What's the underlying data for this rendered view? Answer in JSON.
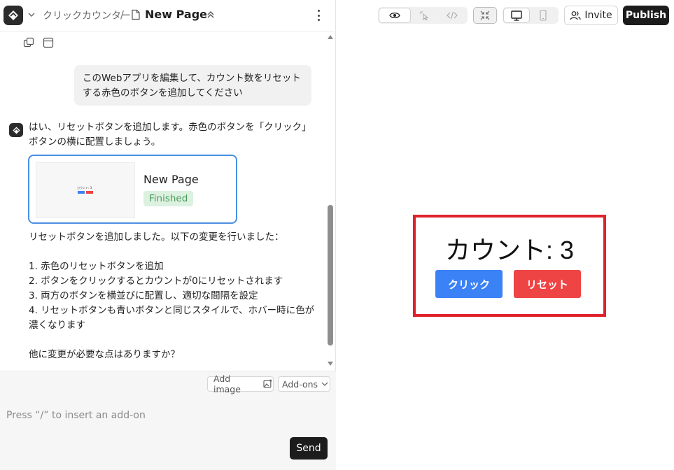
{
  "header": {
    "project_name": "クリックカウンター",
    "separator": "/",
    "page_name": "New Page"
  },
  "chat": {
    "user_message": "このWebアプリを編集して、カウント数をリセットする赤色のボタンを追加してください",
    "bot_intro": "はい、リセットボタンを追加します。赤色のボタンを「クリック」ボタンの横に配置しましょう。",
    "artifact": {
      "title": "New Page",
      "status": "Finished",
      "thumb_text": "カウント: 3"
    },
    "bot_summary": "リセットボタンを追加しました。以下の変更を行いました：\n\n1. 赤色のリセットボタンを追加\n2. ボタンをクリックするとカウントが0にリセットされます\n3. 両方のボタンを横並びに配置し、適切な間隔を設定\n4. リセットボタンも青いボタンと同じスタイルで、ホバー時に色が濃くなります\n\n他に変更が必要な点はありますか？"
  },
  "composer": {
    "add_image_label": "Add image",
    "addons_label": "Add-ons",
    "placeholder": "Press “/” to insert an add-on",
    "send_label": "Send"
  },
  "toolbar": {
    "invite_label": "Invite",
    "publish_label": "Publish"
  },
  "preview": {
    "count_text": "カウント: 3",
    "click_label": "クリック",
    "reset_label": "リセット"
  },
  "colors": {
    "click_button": "#3b82f6",
    "reset_button": "#ef4444",
    "highlight_border": "#e0222c",
    "artifact_border": "#4a90e2",
    "badge_bg": "#dcf1e0",
    "badge_text": "#4a9a5a"
  }
}
